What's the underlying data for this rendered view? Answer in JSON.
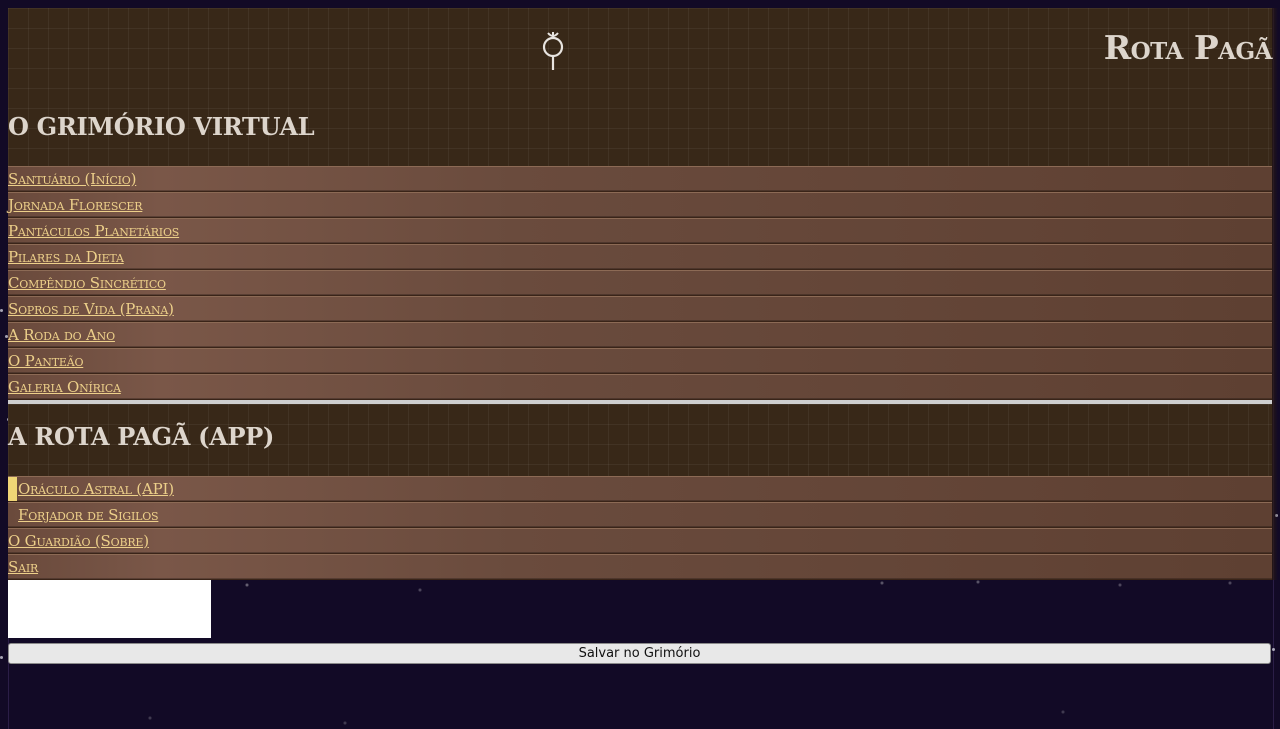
{
  "header": {
    "symbol_icon": "mercury-symbol-icon",
    "title": "Rota Pagã"
  },
  "grimoire": {
    "heading": "O GRIMÓRIO VIRTUAL",
    "items": [
      {
        "label": "Santuário (Início)"
      },
      {
        "label": "Jornada Florescer"
      },
      {
        "label": "Pantáculos Planetários"
      },
      {
        "label": "Pilares da Dieta"
      },
      {
        "label": "Compêndio Sincrético"
      },
      {
        "label": "Sopros de Vida (Prana)"
      },
      {
        "label": "A Roda do Ano"
      },
      {
        "label": "O Panteão"
      },
      {
        "label": "Galeria Onírica"
      }
    ]
  },
  "app": {
    "heading": "A ROTA PAGÃ (APP)",
    "items": [
      {
        "label": "Oráculo Astral (API)"
      },
      {
        "label": "Forjador de Sigilos"
      },
      {
        "label": "O Guardião (Sobre)"
      },
      {
        "label": "Sair"
      }
    ]
  },
  "form": {
    "save_label": "Salvar no Grimório"
  },
  "colors": {
    "background": "#120a26",
    "panel_dark": "#382818",
    "nav_item": "#6a4a3c",
    "link": "#edd08a",
    "active_marker": "#f0d676",
    "heading": "#ddd5cc"
  }
}
